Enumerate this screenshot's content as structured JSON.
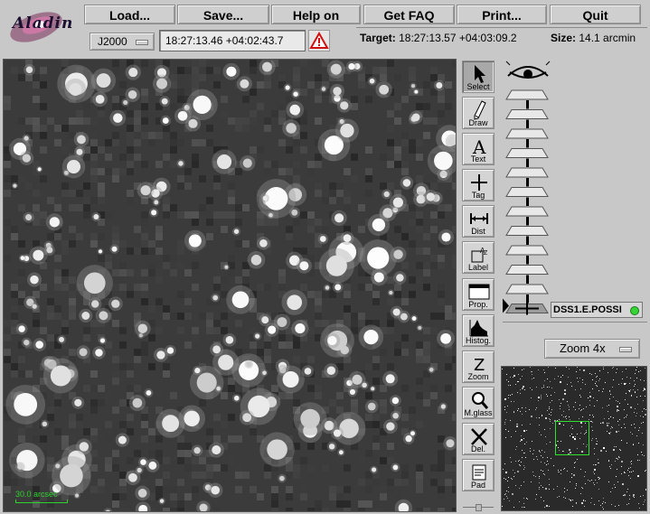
{
  "app": {
    "logo_text": "Aladin"
  },
  "menu": [
    {
      "id": "load",
      "label": "Load..."
    },
    {
      "id": "save",
      "label": "Save..."
    },
    {
      "id": "help",
      "label": "Help on"
    },
    {
      "id": "faq",
      "label": "Get FAQ"
    },
    {
      "id": "print",
      "label": "Print..."
    },
    {
      "id": "quit",
      "label": "Quit"
    }
  ],
  "position": {
    "frame": "J2000",
    "coordinates": "18:27:13.46 +04:02:43.7"
  },
  "info": {
    "target_label": "Target:",
    "target_value": "18:27:13.57 +04:03:09.2",
    "size_label": "Size:",
    "size_value": "14.1 arcmin"
  },
  "view": {
    "scale_label": "30.0 arcsec"
  },
  "tools": [
    {
      "id": "select",
      "label": "Select",
      "icon": "arrow-cursor-icon",
      "active": true
    },
    {
      "id": "draw",
      "label": "Draw",
      "icon": "pencil-icon"
    },
    {
      "id": "text",
      "label": "Text",
      "icon": "letter-a-icon"
    },
    {
      "id": "tag",
      "label": "Tag",
      "icon": "crosshair-icon"
    },
    {
      "id": "dist",
      "label": "Dist",
      "icon": "distance-icon"
    },
    {
      "id": "label",
      "label": "Label",
      "icon": "label-icon"
    },
    {
      "id": "prop",
      "label": "Prop.",
      "icon": "window-icon"
    },
    {
      "id": "histog",
      "label": "Histog.",
      "icon": "histogram-icon"
    },
    {
      "id": "zoom",
      "label": "Zoom",
      "icon": "letter-z-icon"
    },
    {
      "id": "mglass",
      "label": "M.glass",
      "icon": "magnifier-icon"
    },
    {
      "id": "del",
      "label": "Del.",
      "icon": "cross-icon"
    },
    {
      "id": "pad",
      "label": "Pad",
      "icon": "notepad-icon"
    }
  ],
  "stack": {
    "plane_count": 12,
    "active_plane": "DSS1.E.POSSI",
    "status_color": "#35d535"
  },
  "zoom": {
    "value": "Zoom 4x"
  },
  "colors": {
    "accent_green": "#2fd22f"
  }
}
